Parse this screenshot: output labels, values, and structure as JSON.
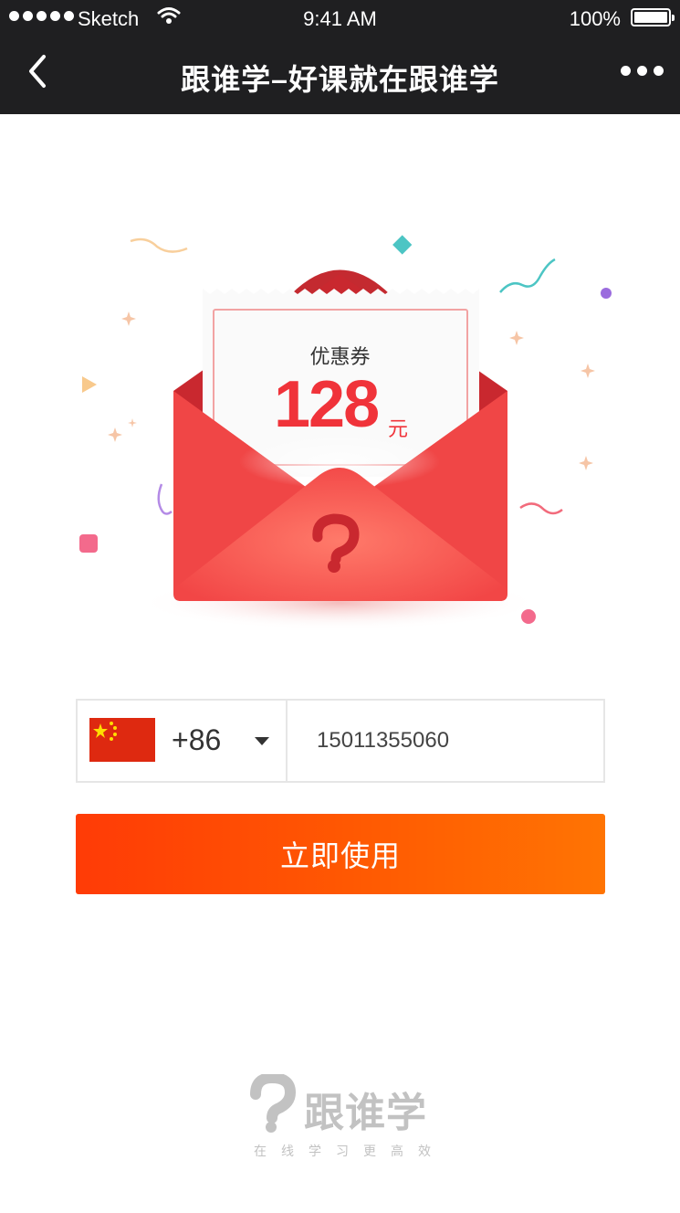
{
  "status_bar": {
    "carrier": "Sketch",
    "time": "9:41 AM",
    "battery": "100%"
  },
  "nav": {
    "title": "跟谁学–好课就在跟谁学",
    "back_icon": "chevron-left-icon",
    "more_icon": "more-dots-icon"
  },
  "coupon": {
    "label": "优惠券",
    "amount": "128",
    "unit": "元"
  },
  "phone": {
    "country_code": "+86",
    "number": "15011355060",
    "flag_icon": "china-flag-icon"
  },
  "cta": {
    "label": "立即使用"
  },
  "footer": {
    "brand": "跟谁学",
    "slogan": "在线学习更高效"
  },
  "colors": {
    "nav_bg": "#1f1f21",
    "envelope_red": "#f04848",
    "price_red": "#f0333a",
    "cta_start": "#ff3b06",
    "cta_end": "#ff7403",
    "logo_gray": "#c2c2c2"
  }
}
